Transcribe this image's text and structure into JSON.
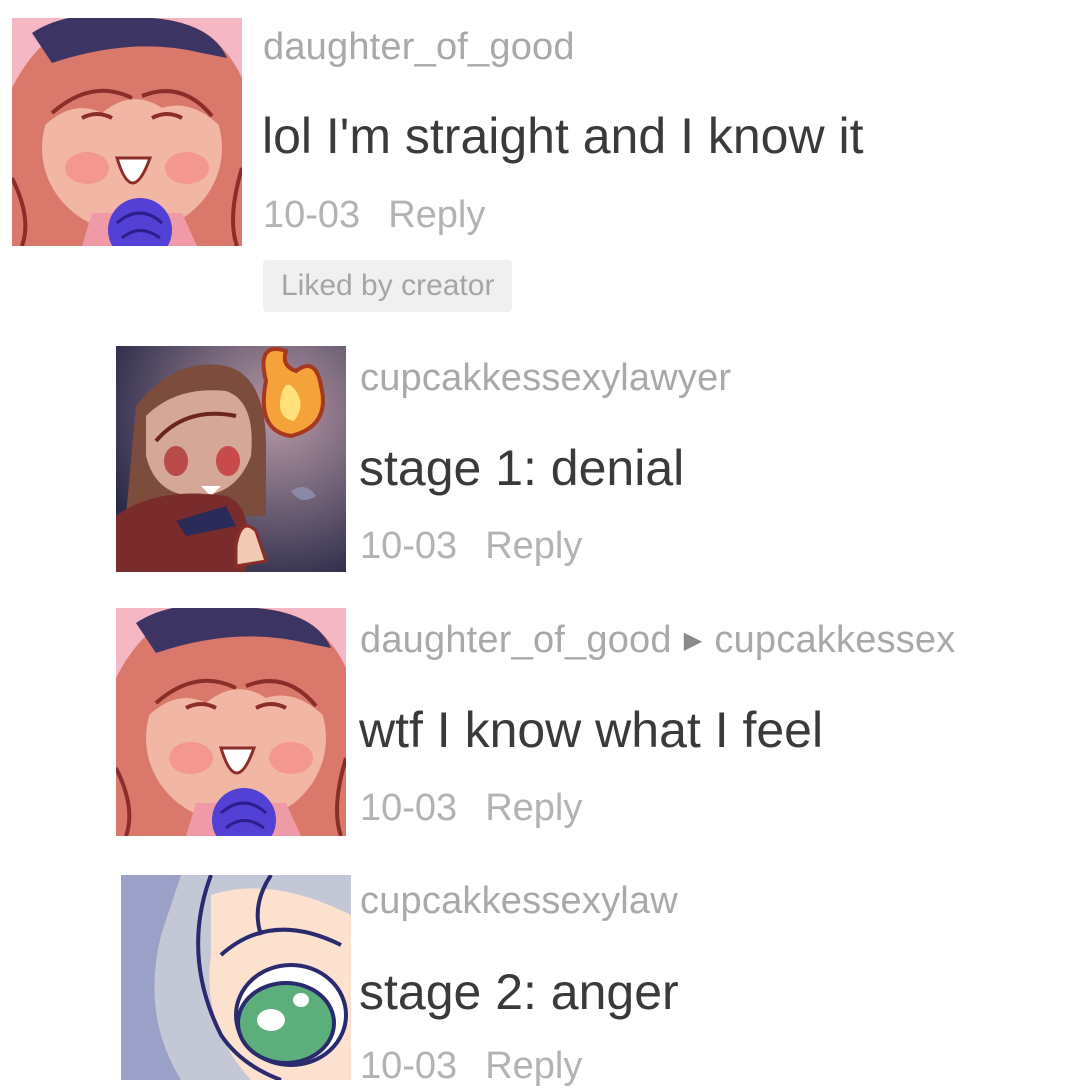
{
  "comments": [
    {
      "username": "daughter_of_good",
      "text": "lol I'm straight and I know it",
      "date": "10-03",
      "reply": "Reply",
      "badge": "Liked by creator",
      "avatar_icon": "avatar-girl-pink-icon"
    },
    {
      "username": "cupcakkessexylawyer",
      "text": "stage 1: denial",
      "date": "10-03",
      "reply": "Reply",
      "avatar_icon": "avatar-girl-fire-icon"
    },
    {
      "username": "daughter_of_good",
      "reply_to": "cupcakkessex",
      "text": "wtf I know what I feel",
      "date": "10-03",
      "reply": "Reply",
      "avatar_icon": "avatar-girl-pink-icon"
    },
    {
      "username": "cupcakkessexylaw",
      "text": "stage 2: anger",
      "date": "10-03",
      "reply": "Reply",
      "avatar_icon": "avatar-green-eye-icon"
    }
  ],
  "colors": {
    "username": "#a9a9a9",
    "text": "#3a3a3a",
    "meta": "#b3b3b3",
    "badge_bg": "#f0f0f0"
  }
}
